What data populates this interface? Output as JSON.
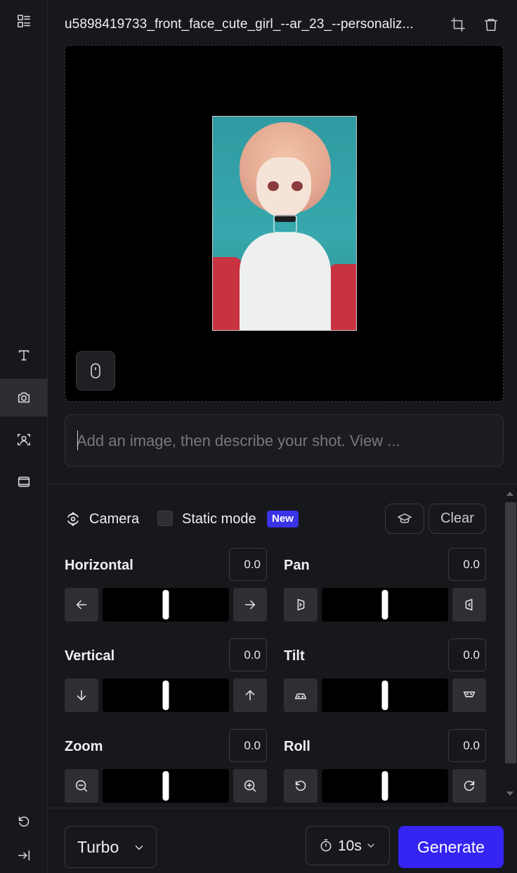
{
  "sidebar": {
    "items": [
      {
        "icon": "layout-list-icon"
      },
      {
        "icon": "text-icon"
      },
      {
        "icon": "camera-icon",
        "active": true
      },
      {
        "icon": "face-scan-icon"
      },
      {
        "icon": "frames-icon"
      }
    ],
    "bottom": [
      {
        "icon": "undo-icon"
      },
      {
        "icon": "collapse-sidebar-icon"
      }
    ]
  },
  "header": {
    "filename": "u5898419733_front_face_cute_girl_--ar_23_--personaliz...",
    "crop_icon": "crop-icon",
    "delete_icon": "trash-icon"
  },
  "canvas": {
    "image_description_icon": "camera-focus-icon",
    "mouse_icon": "mouse-icon"
  },
  "prompt": {
    "placeholder": "Add an image, then describe your shot. View ..."
  },
  "camera_panel": {
    "title": "Camera",
    "static_mode_label": "Static mode",
    "static_mode_checked": false,
    "new_badge": "New",
    "clear_label": "Clear",
    "controls": [
      {
        "label": "Horizontal",
        "value": "0.0",
        "level": 0.5,
        "left_icon": "arrow-left-icon",
        "right_icon": "arrow-right-icon"
      },
      {
        "label": "Pan",
        "value": "0.0",
        "level": 0.5,
        "left_icon": "pan-left-icon",
        "right_icon": "pan-right-icon"
      },
      {
        "label": "Vertical",
        "value": "0.0",
        "level": 0.5,
        "left_icon": "arrow-down-icon",
        "right_icon": "arrow-up-icon"
      },
      {
        "label": "Tilt",
        "value": "0.0",
        "level": 0.5,
        "left_icon": "tilt-down-icon",
        "right_icon": "tilt-up-icon"
      },
      {
        "label": "Zoom",
        "value": "0.0",
        "level": 0.5,
        "left_icon": "zoom-out-icon",
        "right_icon": "zoom-in-icon"
      },
      {
        "label": "Roll",
        "value": "0.0",
        "level": 0.5,
        "left_icon": "rotate-ccw-icon",
        "right_icon": "rotate-cw-icon"
      }
    ]
  },
  "footer": {
    "model_label": "Turbo",
    "duration_label": "10s",
    "generate_label": "Generate"
  },
  "colors": {
    "background": "#17181b",
    "accent": "#3524f2",
    "badge": "#3a33e8"
  }
}
